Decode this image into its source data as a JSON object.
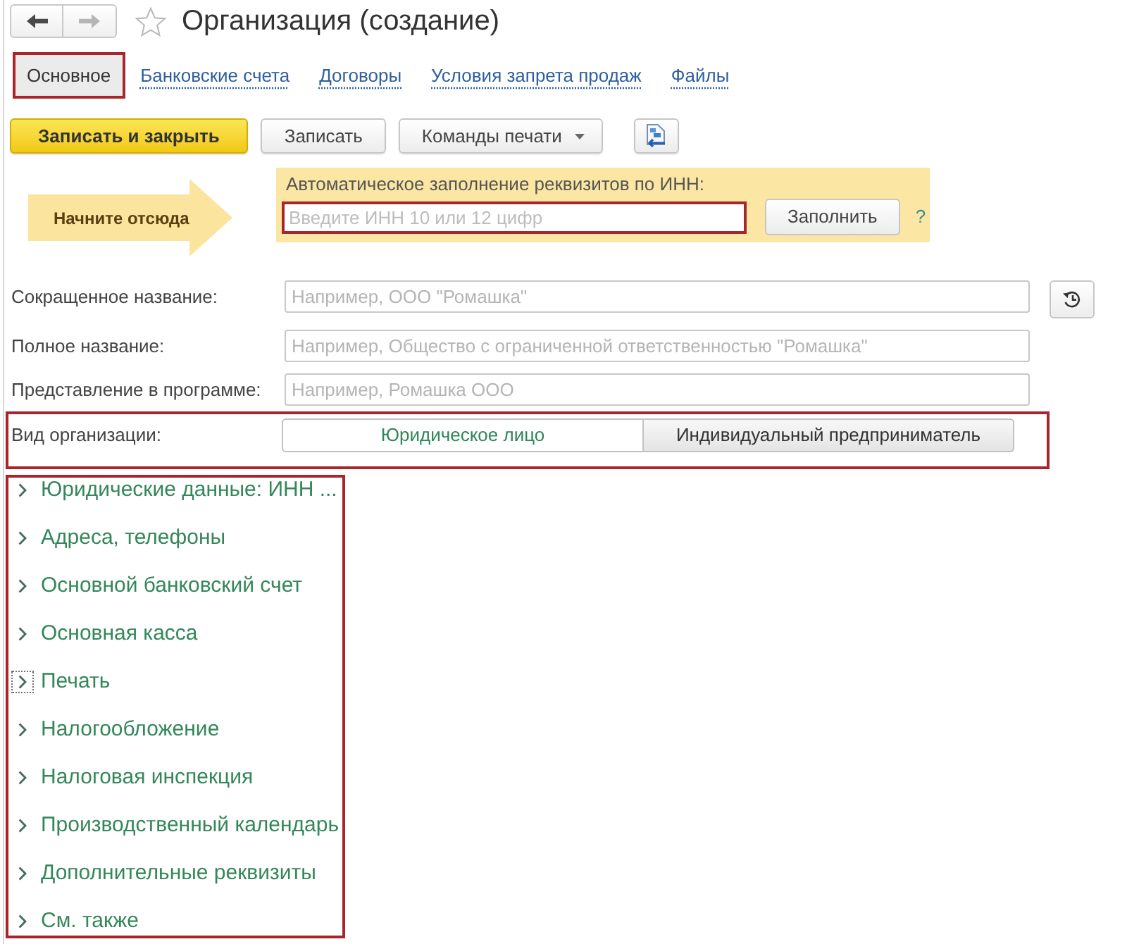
{
  "navigation": [
    {
      "kind": "back",
      "disabled": false
    },
    {
      "kind": "forward",
      "disabled": true
    }
  ],
  "window": {
    "title": "Организация (создание)",
    "starred": false
  },
  "tabs": [
    {
      "label": "Основное",
      "selected": true,
      "highlighted": true
    },
    {
      "label": "Банковские счета",
      "selected": false,
      "highlighted": false
    },
    {
      "label": "Договоры",
      "selected": false,
      "highlighted": false
    },
    {
      "label": "Условия запрета продаж",
      "selected": false,
      "highlighted": false
    },
    {
      "label": "Файлы",
      "selected": false,
      "highlighted": false
    }
  ],
  "command_bar": [
    {
      "kind": "primary",
      "label": "Записать и закрыть"
    },
    {
      "kind": "default",
      "label": "Записать"
    },
    {
      "kind": "dropdown",
      "label": "Команды печати"
    },
    {
      "kind": "icon"
    }
  ],
  "autofill": {
    "callout": "Начните отсюда",
    "label": "Автоматическое заполнение реквизитов по ИНН:",
    "input": {
      "placeholder": "Введите ИНН 10 или 12 цифр",
      "highlighted": true
    },
    "button": "Заполнить",
    "help": "?"
  },
  "fields": [
    {
      "label": "Сокращенное название:",
      "placeholder": "Например, ООО \"Ромашка\"",
      "history_button": true
    },
    {
      "label": "Полное название:",
      "placeholder": "Например, Общество с ограниченной ответственностью \"Ромашка\"",
      "history_button": false
    },
    {
      "label": "Представление в программе:",
      "placeholder": "Например, Ромашка ООО",
      "history_button": false
    }
  ],
  "organization_type": {
    "label": "Вид организации:",
    "highlighted": true,
    "options": [
      {
        "label": "Юридическое лицо",
        "selected": true
      },
      {
        "label": "Индивидуальный предприниматель",
        "selected": false
      }
    ]
  },
  "sections": {
    "highlighted": true,
    "items": [
      {
        "title": "Юридические данные: ИНН ...",
        "expanded": false,
        "focused": false
      },
      {
        "title": "Адреса, телефоны",
        "expanded": false,
        "focused": false
      },
      {
        "title": "Основной банковский счет",
        "expanded": false,
        "focused": false
      },
      {
        "title": "Основная касса",
        "expanded": false,
        "focused": false
      },
      {
        "title": "Печать",
        "expanded": false,
        "focused": true
      },
      {
        "title": "Налогообложение",
        "expanded": false,
        "focused": false
      },
      {
        "title": "Налоговая инспекция",
        "expanded": false,
        "focused": false
      },
      {
        "title": "Производственный календарь",
        "expanded": false,
        "focused": false
      },
      {
        "title": "Дополнительные реквизиты",
        "expanded": false,
        "focused": false
      },
      {
        "title": "См. также",
        "expanded": false,
        "focused": false
      }
    ]
  }
}
